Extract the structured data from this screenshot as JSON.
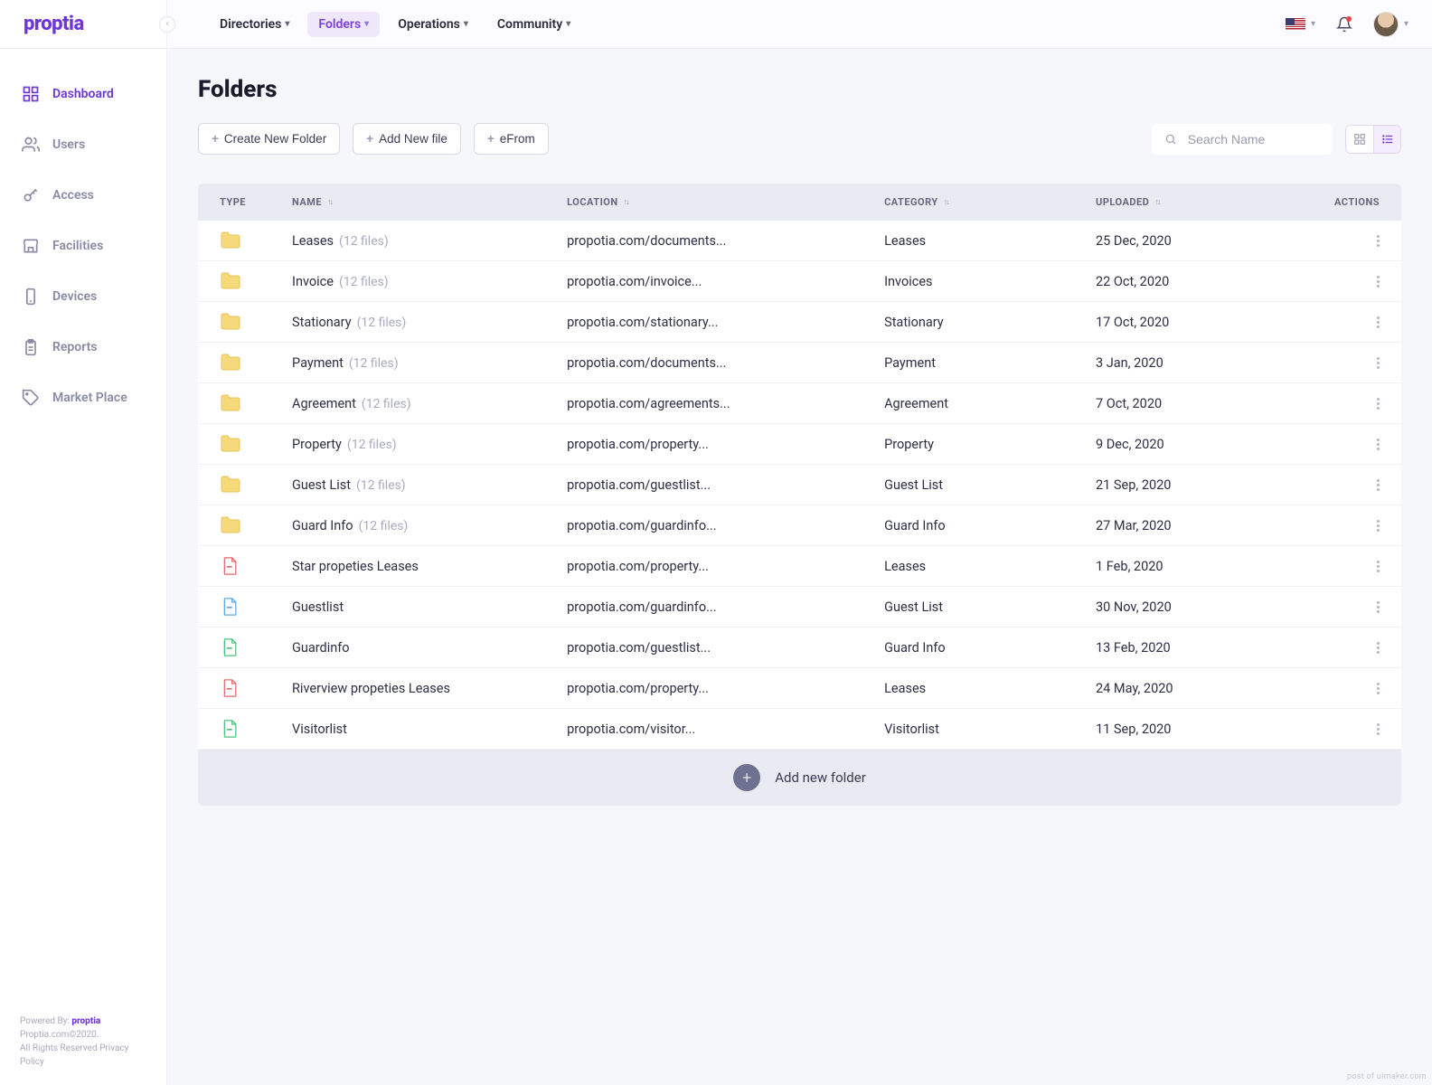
{
  "brand": "proptia",
  "topnav": [
    {
      "label": "Directories",
      "active": false
    },
    {
      "label": "Folders",
      "active": true
    },
    {
      "label": "Operations",
      "active": false
    },
    {
      "label": "Community",
      "active": false
    }
  ],
  "sidebar": {
    "items": [
      {
        "label": "Dashboard",
        "icon": "grid",
        "active": true
      },
      {
        "label": "Users",
        "icon": "users",
        "active": false
      },
      {
        "label": "Access",
        "icon": "key",
        "active": false
      },
      {
        "label": "Facilities",
        "icon": "store",
        "active": false
      },
      {
        "label": "Devices",
        "icon": "phone",
        "active": false
      },
      {
        "label": "Reports",
        "icon": "clipboard",
        "active": false
      },
      {
        "label": "Market Place",
        "icon": "tag",
        "active": false
      }
    ]
  },
  "footer": {
    "line1_prefix": "Powered By: ",
    "line1_brand": "proptia",
    "line2": "Proptia.com©2020.",
    "line3": "All Rights Reserved Privacy Policy"
  },
  "page": {
    "title": "Folders",
    "btn_create": "Create New Folder",
    "btn_addfile": "Add New file",
    "btn_efrom": "eFrom",
    "search_placeholder": "Search Name",
    "add_row_label": "Add new folder"
  },
  "columns": {
    "type": "TYPE",
    "name": "NAME",
    "location": "LOCATION",
    "category": "CATEGORY",
    "uploaded": "UPLOADED",
    "actions": "ACTIONS"
  },
  "rows": [
    {
      "kind": "folder",
      "name": "Leases",
      "files": "(12 files)",
      "location": "propotia.com/documents...",
      "category": "Leases",
      "uploaded": "25 Dec, 2020"
    },
    {
      "kind": "folder",
      "name": "Invoice",
      "files": "(12 files)",
      "location": "propotia.com/invoice...",
      "category": "Invoices",
      "uploaded": "22 Oct, 2020"
    },
    {
      "kind": "folder",
      "name": "Stationary",
      "files": "(12 files)",
      "location": "propotia.com/stationary...",
      "category": "Stationary",
      "uploaded": "17 Oct, 2020"
    },
    {
      "kind": "folder",
      "name": "Payment",
      "files": "(12 files)",
      "location": "propotia.com/documents...",
      "category": "Payment",
      "uploaded": "3 Jan, 2020"
    },
    {
      "kind": "folder",
      "name": "Agreement",
      "files": "(12 files)",
      "location": "propotia.com/agreements...",
      "category": "Agreement",
      "uploaded": "7 Oct, 2020"
    },
    {
      "kind": "folder",
      "name": "Property",
      "files": "(12 files)",
      "location": "propotia.com/property...",
      "category": "Property",
      "uploaded": "9 Dec, 2020"
    },
    {
      "kind": "folder",
      "name": "Guest List",
      "files": "(12 files)",
      "location": "propotia.com/guestlist...",
      "category": "Guest List",
      "uploaded": "21 Sep, 2020"
    },
    {
      "kind": "folder",
      "name": "Guard Info",
      "files": "(12 files)",
      "location": "propotia.com/guardinfo...",
      "category": "Guard Info",
      "uploaded": "27 Mar, 2020"
    },
    {
      "kind": "file",
      "color": "#e26a6a",
      "name": "Star propeties Leases",
      "location": "propotia.com/property...",
      "category": "Leases",
      "uploaded": "1 Feb, 2020"
    },
    {
      "kind": "file",
      "color": "#5aa8e2",
      "name": "Guestlist",
      "location": "propotia.com/guardinfo...",
      "category": "Guest List",
      "uploaded": "30 Nov, 2020"
    },
    {
      "kind": "file",
      "color": "#4bbf7d",
      "name": "Guardinfo",
      "location": "propotia.com/guestlist...",
      "category": "Guard Info",
      "uploaded": "13 Feb, 2020"
    },
    {
      "kind": "file",
      "color": "#e26a6a",
      "name": "Riverview propeties Leases",
      "location": "propotia.com/property...",
      "category": "Leases",
      "uploaded": "24 May, 2020"
    },
    {
      "kind": "file",
      "color": "#4bbf7d",
      "name": "Visitorlist",
      "location": "propotia.com/visitor...",
      "category": "Visitorlist",
      "uploaded": "11 Sep, 2020"
    }
  ],
  "watermark": "post of uimaker.com"
}
